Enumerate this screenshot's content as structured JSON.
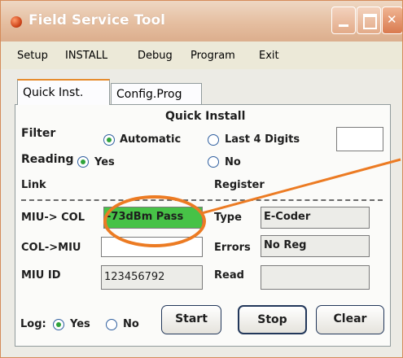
{
  "window": {
    "title": "Field Service Tool"
  },
  "menu": {
    "items": [
      "Setup",
      "INSTALL",
      "Debug",
      "Program",
      "Exit"
    ]
  },
  "tabs": {
    "active": "Quick Inst.",
    "other": "Config.Prog"
  },
  "panel": {
    "heading": "Quick Install",
    "filter": {
      "label": "Filter",
      "option_auto": "Automatic",
      "option_last4": "Last 4 Digits",
      "selected": "Automatic",
      "input_value": ""
    },
    "reading": {
      "label": "Reading",
      "option_yes": "Yes",
      "option_no": "No",
      "selected": "Yes"
    },
    "link_header": "Link",
    "register_header": "Register",
    "miu_col": {
      "label": "MIU-> COL",
      "value": "-73dBm Pass"
    },
    "col_miu": {
      "label": "COL->MIU",
      "value": ""
    },
    "miu_id": {
      "label": "MIU ID",
      "value": "123456792"
    },
    "type": {
      "label": "Type",
      "value": "E-Coder"
    },
    "errors": {
      "label": "Errors",
      "value": "No Reg"
    },
    "read": {
      "label": "Read",
      "value": ""
    },
    "log": {
      "label": "Log:",
      "option_yes": "Yes",
      "option_no": "No",
      "selected": "Yes"
    },
    "buttons": {
      "start": "Start",
      "stop": "Stop",
      "clear": "Clear"
    }
  },
  "colors": {
    "accent": "#ec7b23",
    "pass": "#47c247",
    "title_bar": "#e5bea0"
  }
}
